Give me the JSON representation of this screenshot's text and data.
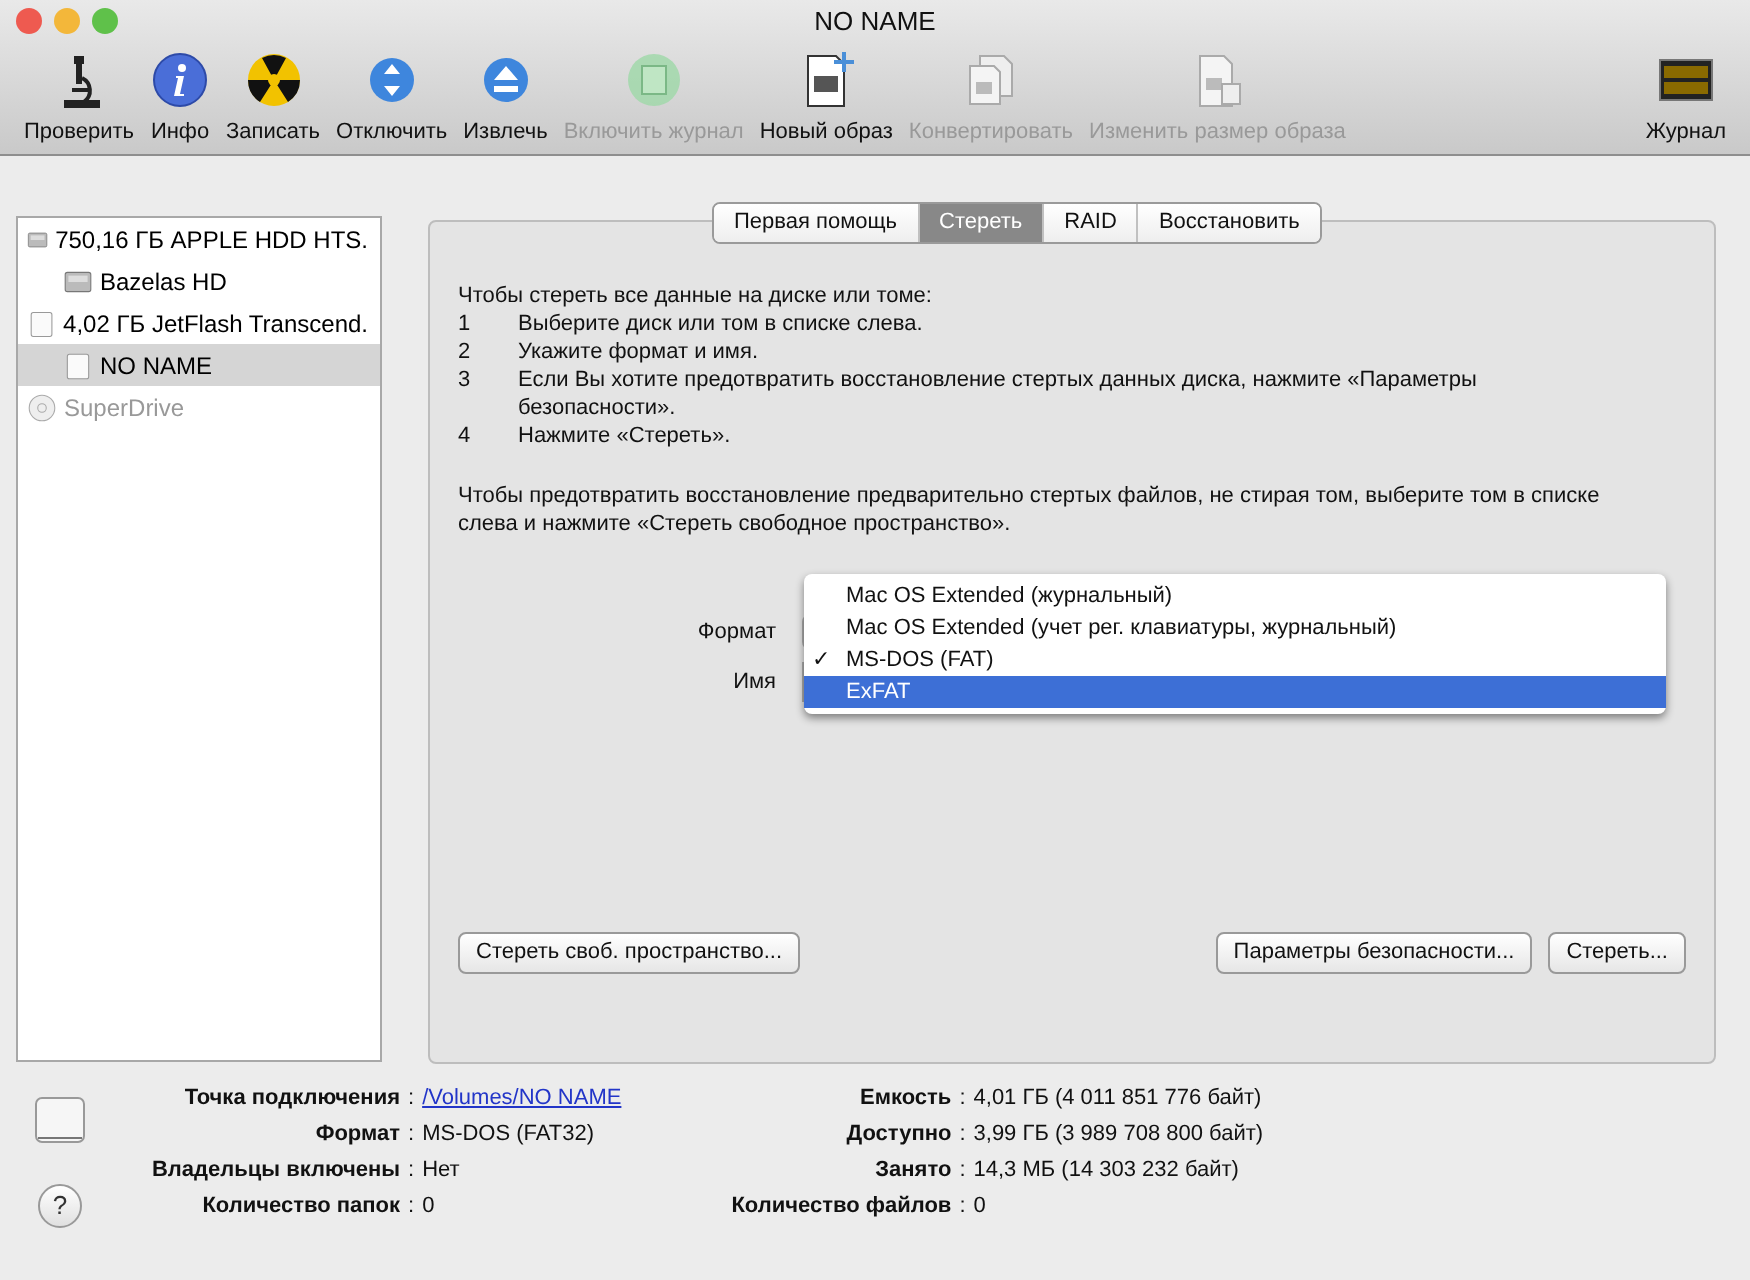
{
  "window": {
    "title": "NO NAME"
  },
  "toolbar": [
    {
      "label": "Проверить",
      "disabled": false
    },
    {
      "label": "Инфо",
      "disabled": false
    },
    {
      "label": "Записать",
      "disabled": false
    },
    {
      "label": "Отключить",
      "disabled": false
    },
    {
      "label": "Извлечь",
      "disabled": false
    },
    {
      "label": "Включить журнал",
      "disabled": true
    },
    {
      "label": "Новый образ",
      "disabled": false
    },
    {
      "label": "Конвертировать",
      "disabled": true
    },
    {
      "label": "Изменить размер образа",
      "disabled": true
    },
    {
      "label": "Журнал",
      "disabled": false
    }
  ],
  "sidebar": {
    "items": [
      {
        "label": "750,16 ГБ APPLE HDD HTS.",
        "kind": "hdd",
        "selected": false,
        "disabled": false,
        "children": [
          {
            "label": "Bazelas HD",
            "kind": "hdd",
            "selected": false,
            "disabled": false
          }
        ]
      },
      {
        "label": "4,02 ГБ JetFlash Transcend.",
        "kind": "flash",
        "selected": false,
        "disabled": false,
        "children": [
          {
            "label": "NO NAME",
            "kind": "flash",
            "selected": true,
            "disabled": false
          }
        ]
      },
      {
        "label": "SuperDrive",
        "kind": "optical",
        "selected": false,
        "disabled": true
      }
    ]
  },
  "tabs": [
    {
      "label": "Первая помощь",
      "selected": false
    },
    {
      "label": "Стереть",
      "selected": true
    },
    {
      "label": "RAID",
      "selected": false
    },
    {
      "label": "Восстановить",
      "selected": false
    }
  ],
  "erase": {
    "intro": "Чтобы стереть все данные на диске или томе:",
    "steps": [
      {
        "number": "1",
        "text": "Выберите диск или том в списке слева."
      },
      {
        "number": "2",
        "text": "Укажите формат и имя."
      },
      {
        "number": "3",
        "text": "Если Вы хотите предотвратить восстановление стертых данных диска, нажмите «Параметры безопасности»."
      },
      {
        "number": "4",
        "text": "Нажмите «Стереть»."
      }
    ],
    "note": "Чтобы предотвратить восстановление предварительно стертых файлов, не стирая том, выберите том в списке слева и нажмите «Стереть свободное пространство».",
    "format_label": "Формат",
    "name_label": "Имя",
    "format_menu": [
      {
        "label": "Mac OS Extended (журнальный)",
        "selected": false,
        "highlighted": false
      },
      {
        "label": "Mac OS Extended (учет рег. клавиатуры, журнальный)",
        "selected": false,
        "highlighted": false
      },
      {
        "label": "MS-DOS (FAT)",
        "selected": true,
        "highlighted": false
      },
      {
        "label": "ExFAT",
        "selected": false,
        "highlighted": true
      }
    ],
    "check_mark": "✓",
    "buttons_left": [
      "Стереть своб. пространство..."
    ],
    "buttons_right": [
      "Параметры безопасности...",
      "Стереть..."
    ]
  },
  "info": {
    "left": [
      {
        "label": "Точка подключения",
        "value": "/Volumes/NO NAME",
        "kind": "link"
      },
      {
        "label": "Формат",
        "value": "MS-DOS (FAT32)",
        "kind": "text"
      },
      {
        "label": "Владельцы включены",
        "value": "Нет",
        "kind": "text"
      },
      {
        "label": "Количество папок",
        "value": "0",
        "kind": "text"
      }
    ],
    "right": [
      {
        "label": "Емкость",
        "value": "4,01 ГБ (4 011 851 776 байт)",
        "kind": "text"
      },
      {
        "label": "Доступно",
        "value": "3,99 ГБ (3 989 708 800 байт)",
        "kind": "text"
      },
      {
        "label": "Занято",
        "value": "14,3 МБ (14 303 232 байт)",
        "kind": "text"
      },
      {
        "label": "Количество файлов",
        "value": "0",
        "kind": "text"
      }
    ],
    "separator": ":",
    "help": "?"
  }
}
